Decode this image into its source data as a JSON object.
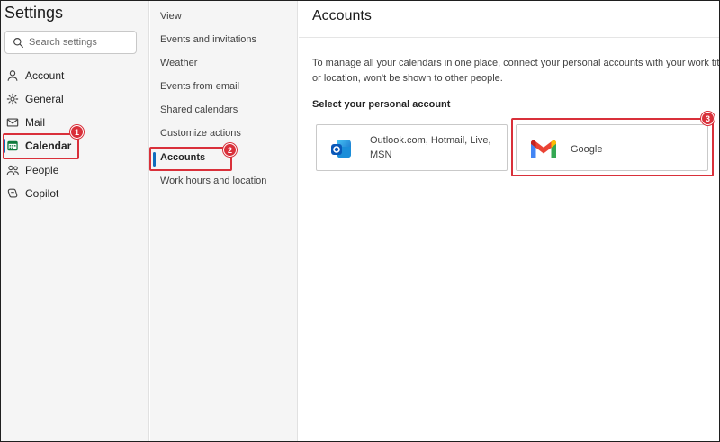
{
  "settings": {
    "title": "Settings",
    "search_placeholder": "Search settings",
    "nav": [
      {
        "label": "Account",
        "icon": "person-icon"
      },
      {
        "label": "General",
        "icon": "gear-icon"
      },
      {
        "label": "Mail",
        "icon": "mail-icon"
      },
      {
        "label": "Calendar",
        "icon": "calendar-icon",
        "active": true
      },
      {
        "label": "People",
        "icon": "people-icon"
      },
      {
        "label": "Copilot",
        "icon": "copilot-icon"
      }
    ]
  },
  "calendar_menu": {
    "items": [
      {
        "label": "View"
      },
      {
        "label": "Events and invitations"
      },
      {
        "label": "Weather"
      },
      {
        "label": "Events from email"
      },
      {
        "label": "Shared calendars"
      },
      {
        "label": "Customize actions"
      },
      {
        "label": "Accounts",
        "active": true
      },
      {
        "label": "Work hours and location"
      }
    ]
  },
  "content": {
    "title": "Accounts",
    "description": "To manage all your calendars in one place, connect your personal accounts with your work title or location, won't be shown to other people.",
    "subheading": "Select your personal account",
    "accounts": [
      {
        "label": "Outlook.com, Hotmail, Live, MSN",
        "icon": "outlook-icon"
      },
      {
        "label": "Google",
        "icon": "gmail-icon"
      }
    ]
  },
  "annotations": {
    "badges": [
      "1",
      "2",
      "3"
    ],
    "color": "#d9303a"
  },
  "colors": {
    "accent": "#0f6cbd",
    "highlight": "#d9303a"
  }
}
